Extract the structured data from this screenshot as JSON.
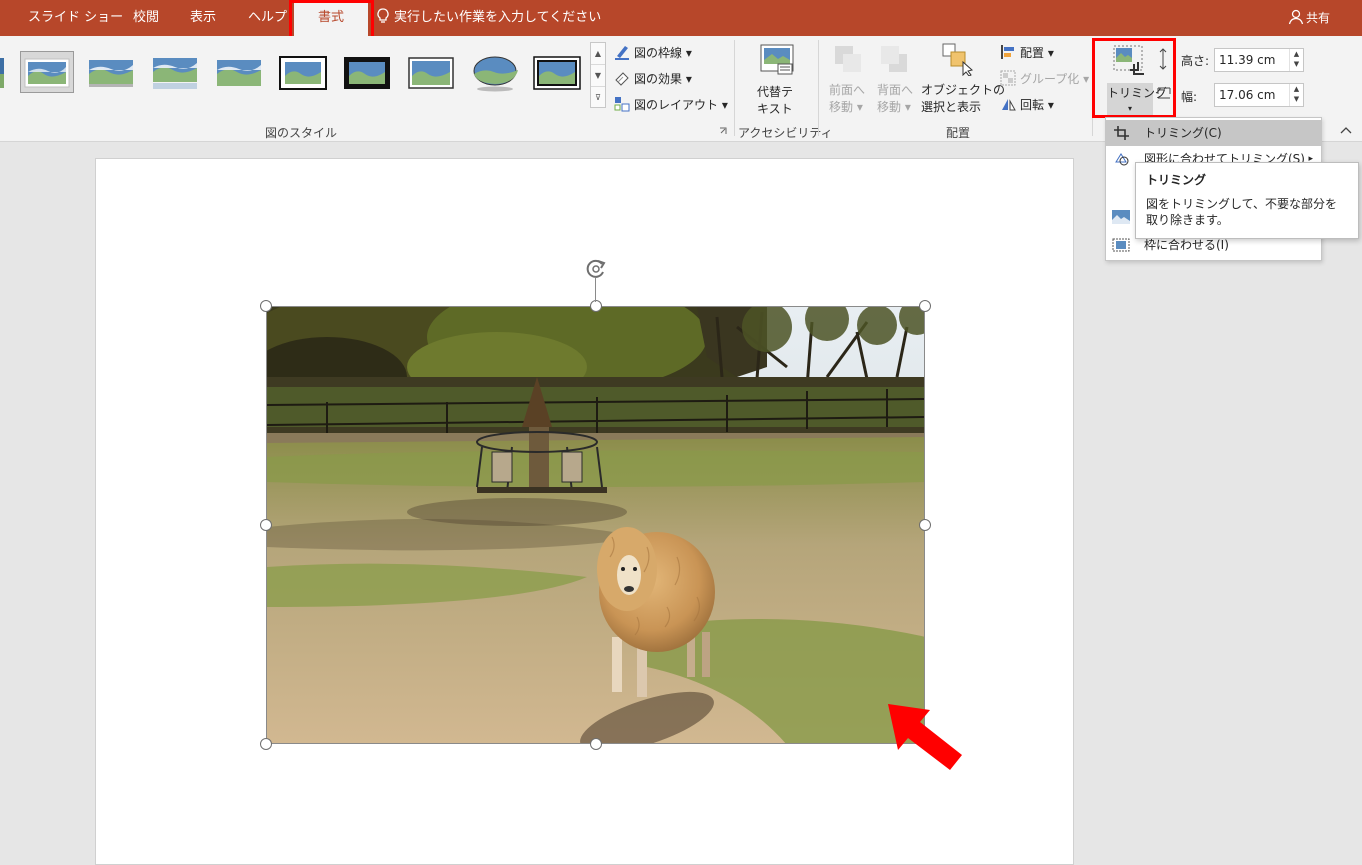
{
  "tabs": [
    {
      "label": "スライド ショー"
    },
    {
      "label": "校閲"
    },
    {
      "label": "表示"
    },
    {
      "label": "ヘルプ"
    },
    {
      "label": "書式",
      "active": true
    }
  ],
  "tell_me": "実行したい作業を入力してください",
  "share": "共有",
  "ribbon": {
    "picture_styles": {
      "border": "図の枠線",
      "effects": "図の効果",
      "layout": "図のレイアウト",
      "group_label": "図のスタイル"
    },
    "accessibility": {
      "alt_text_line1": "代替テ",
      "alt_text_line2": "キスト",
      "group_label": "アクセシビリティ"
    },
    "arrange": {
      "bring_forward_1": "前面へ",
      "bring_forward_2": "移動",
      "send_backward_1": "背面へ",
      "send_backward_2": "移動",
      "selection_pane_1": "オブジェクトの",
      "selection_pane_2": "選択と表示",
      "align": "配置",
      "group": "グループ化",
      "rotate": "回転",
      "group_label": "配置"
    },
    "size": {
      "crop": "トリミング",
      "height_label": "高さ:",
      "height_value": "11.39 cm",
      "width_label": "幅:",
      "width_value": "17.06 cm"
    }
  },
  "crop_menu": {
    "items": [
      {
        "label": "トリミング(C)"
      },
      {
        "label": "図形に合わせてトリミング(S)"
      },
      {
        "label": "枠に合わせる(I)"
      }
    ]
  },
  "tooltip": {
    "title": "トリミング",
    "body": "図をトリミングして、不要な部分を取り除きます。"
  },
  "colors": {
    "accent": "#b7472a",
    "highlight_box": "#ff0000",
    "ribbon_bg": "#f3f3f3"
  }
}
